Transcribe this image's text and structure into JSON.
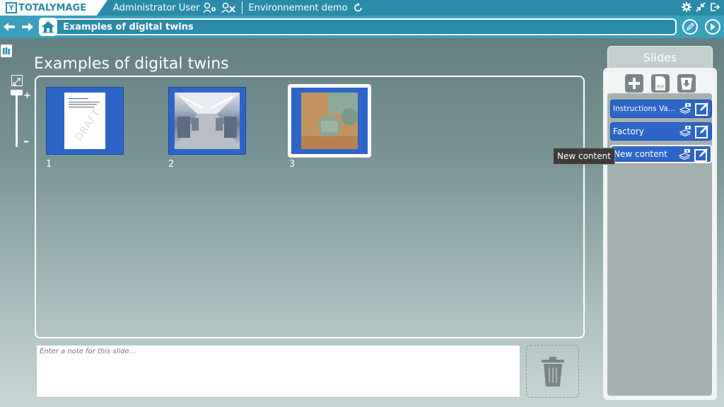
{
  "app": {
    "logo_letter": "Y",
    "logo_text": "TOTALYMAGE",
    "user": "Administrator User",
    "environment": "Environnement demo"
  },
  "nav": {
    "breadcrumb": "Examples of digital twins"
  },
  "page": {
    "title": "Examples of digital twins"
  },
  "zoom": {
    "plus": "+",
    "minus": "–"
  },
  "thumbnails": [
    {
      "label": "1",
      "kind": "document",
      "watermark": "DRAFT"
    },
    {
      "label": "2",
      "kind": "factory-photo"
    },
    {
      "label": "3",
      "kind": "pipe-photo",
      "selected": true
    }
  ],
  "note": {
    "placeholder": "Enter a note for this slide..."
  },
  "slides": {
    "tab_label": "Slides",
    "pdf_label": "PDF",
    "items": [
      {
        "label": "Instructions Vanne..."
      },
      {
        "label": "Factory"
      },
      {
        "label": "New content",
        "active": true
      }
    ],
    "tooltip": "New content"
  },
  "colors": {
    "topbar": "#2a8aa8",
    "navbar": "#3aa0bd",
    "slide_blue": "#2d65c8"
  }
}
